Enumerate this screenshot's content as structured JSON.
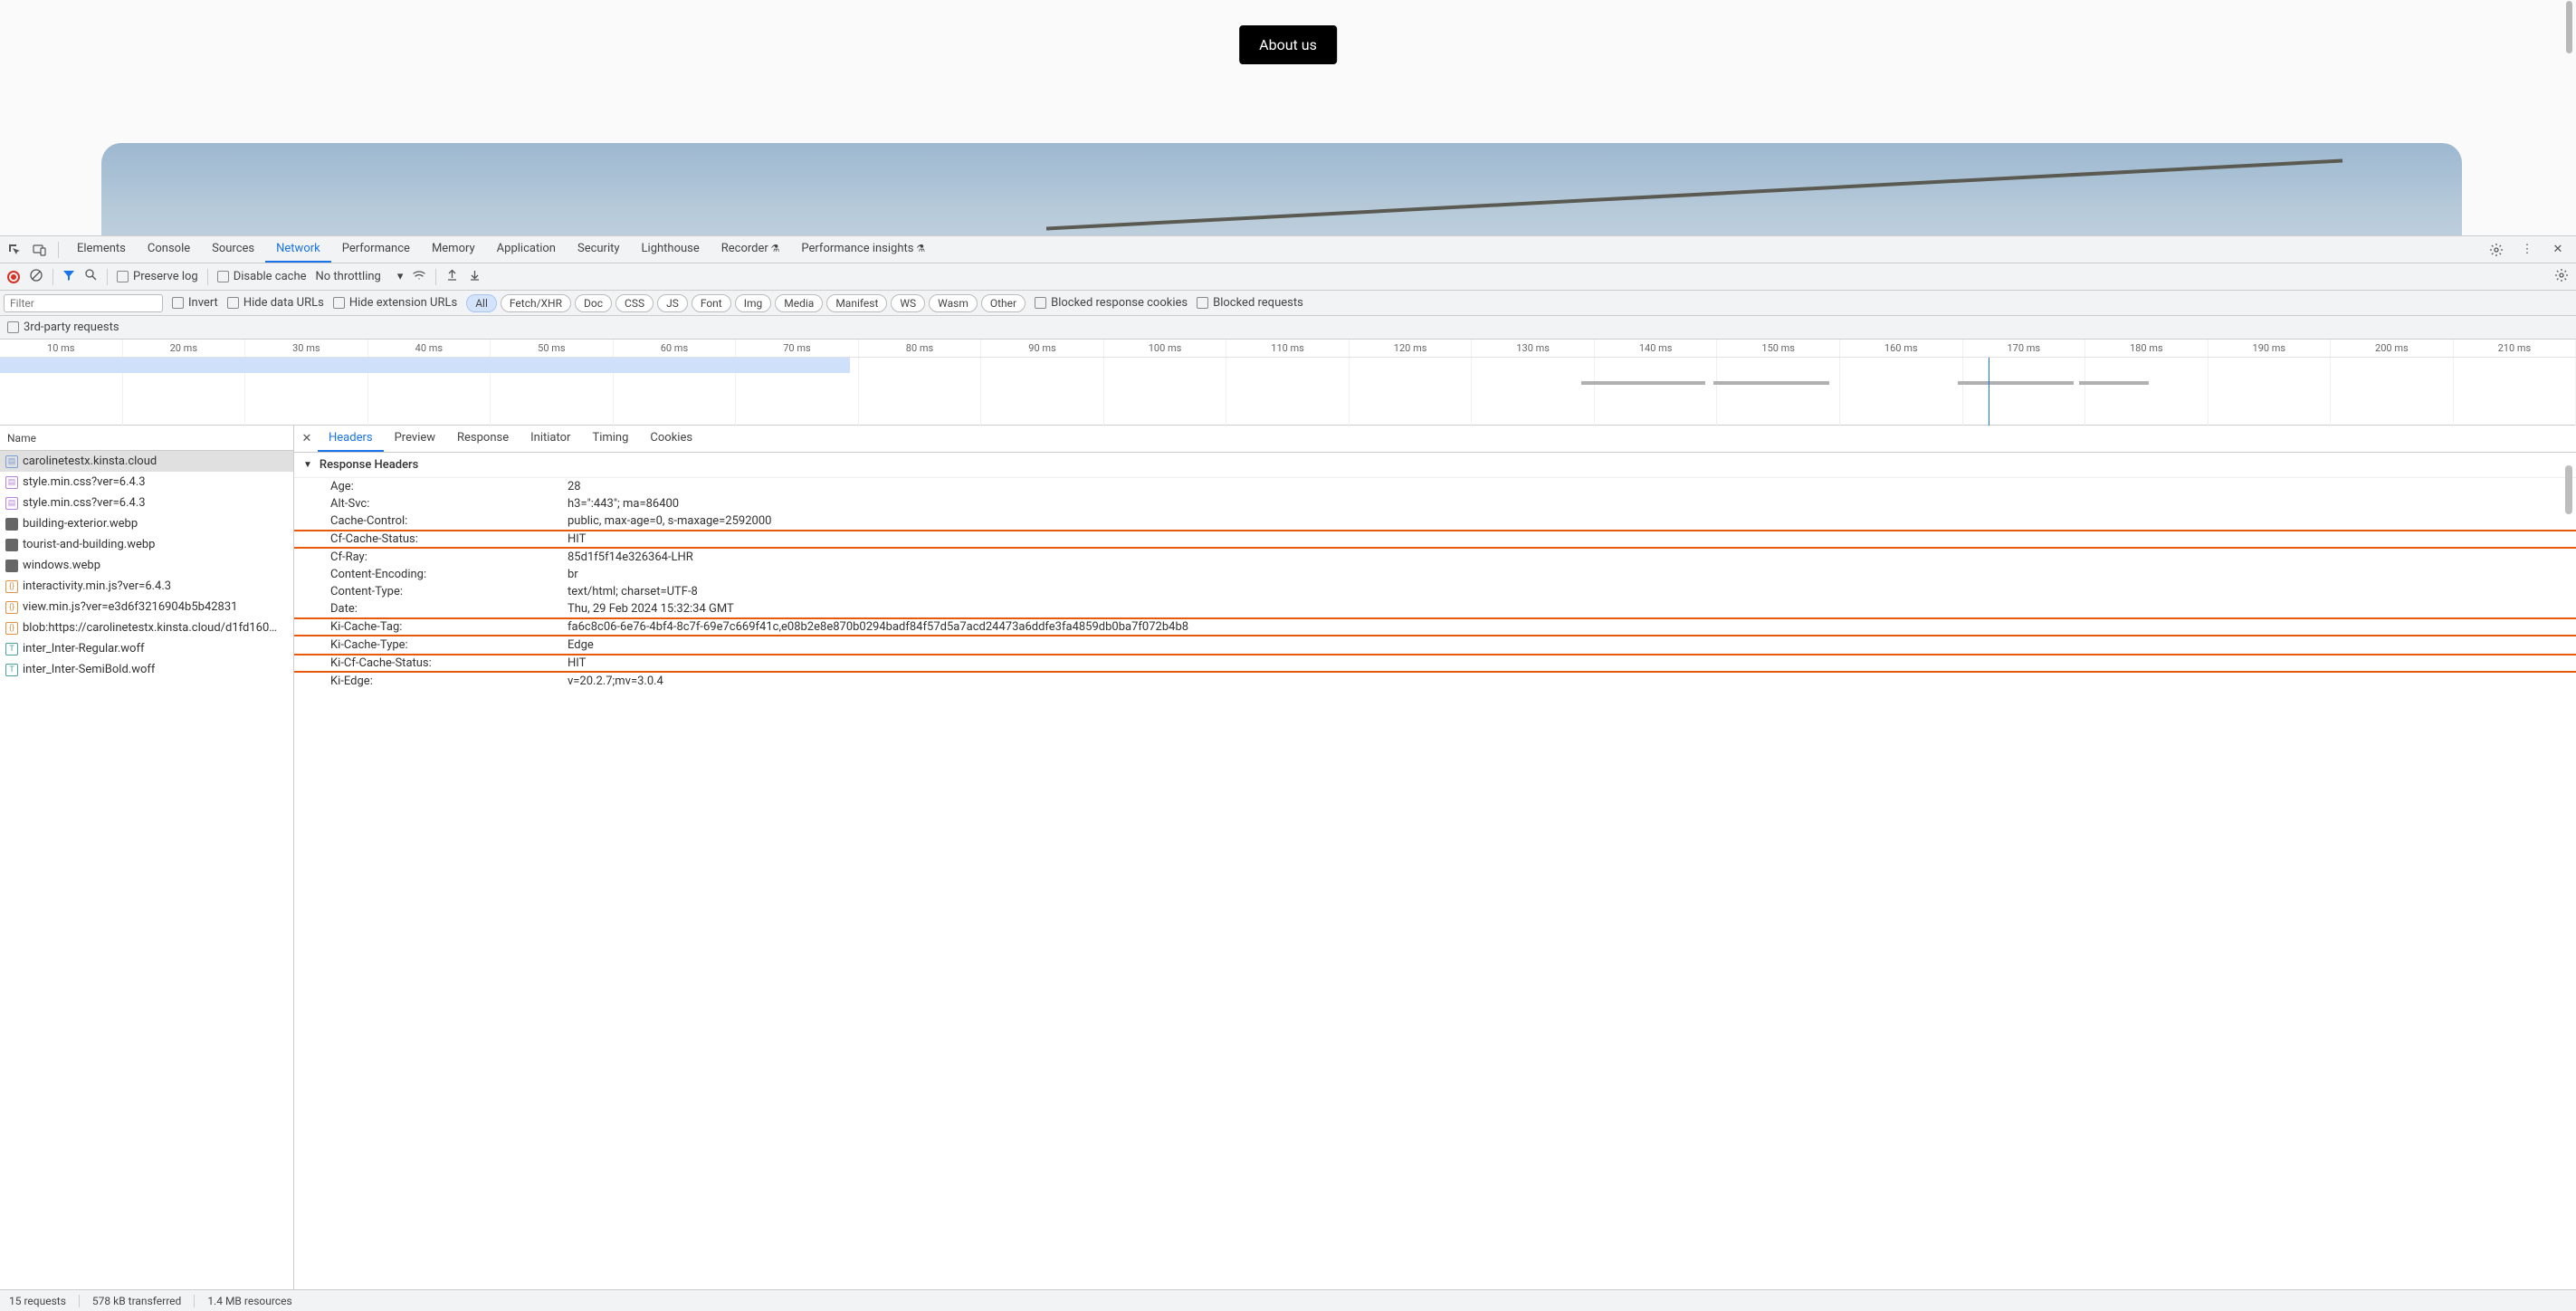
{
  "page": {
    "about_button": "About us"
  },
  "devtools": {
    "tabs": [
      "Elements",
      "Console",
      "Sources",
      "Network",
      "Performance",
      "Memory",
      "Application",
      "Security",
      "Lighthouse",
      "Recorder",
      "Performance insights"
    ],
    "active_tab": 3
  },
  "toolbar": {
    "preserve_log": "Preserve log",
    "disable_cache": "Disable cache",
    "throttling": "No throttling"
  },
  "filterbar": {
    "filter_placeholder": "Filter",
    "invert": "Invert",
    "hide_data": "Hide data URLs",
    "hide_ext": "Hide extension URLs",
    "types": [
      "All",
      "Fetch/XHR",
      "Doc",
      "CSS",
      "JS",
      "Font",
      "Img",
      "Media",
      "Manifest",
      "WS",
      "Wasm",
      "Other"
    ],
    "blocked_cookies": "Blocked response cookies",
    "blocked_requests": "Blocked requests",
    "third_party": "3rd-party requests"
  },
  "timeline": {
    "ticks": [
      "10 ms",
      "20 ms",
      "30 ms",
      "40 ms",
      "50 ms",
      "60 ms",
      "70 ms",
      "80 ms",
      "90 ms",
      "100 ms",
      "110 ms",
      "120 ms",
      "130 ms",
      "140 ms",
      "150 ms",
      "160 ms",
      "170 ms",
      "180 ms",
      "190 ms",
      "200 ms",
      "210 ms"
    ]
  },
  "requests": {
    "name_header": "Name",
    "items": [
      {
        "icon": "doc",
        "name": "carolinetestx.kinsta.cloud",
        "selected": true
      },
      {
        "icon": "css",
        "name": "style.min.css?ver=6.4.3"
      },
      {
        "icon": "css",
        "name": "style.min.css?ver=6.4.3"
      },
      {
        "icon": "img",
        "name": "building-exterior.webp"
      },
      {
        "icon": "img",
        "name": "tourist-and-building.webp"
      },
      {
        "icon": "img",
        "name": "windows.webp"
      },
      {
        "icon": "js",
        "name": "interactivity.min.js?ver=6.4.3"
      },
      {
        "icon": "js",
        "name": "view.min.js?ver=e3d6f3216904b5b42831"
      },
      {
        "icon": "js",
        "name": "blob:https://carolinetestx.kinsta.cloud/d1fd160…"
      },
      {
        "icon": "font",
        "name": "inter_Inter-Regular.woff"
      },
      {
        "icon": "font",
        "name": "inter_Inter-SemiBold.woff"
      }
    ]
  },
  "details": {
    "tabs": [
      "Headers",
      "Preview",
      "Response",
      "Initiator",
      "Timing",
      "Cookies"
    ],
    "active_tab": 0,
    "section": "Response Headers",
    "headers": [
      {
        "key": "Age:",
        "val": "28"
      },
      {
        "key": "Alt-Svc:",
        "val": "h3=\":443\"; ma=86400"
      },
      {
        "key": "Cache-Control:",
        "val": "public, max-age=0, s-maxage=2592000"
      },
      {
        "key": "Cf-Cache-Status:",
        "val": "HIT",
        "hl": true
      },
      {
        "key": "Cf-Ray:",
        "val": "85d1f5f14e326364-LHR"
      },
      {
        "key": "Content-Encoding:",
        "val": "br"
      },
      {
        "key": "Content-Type:",
        "val": "text/html; charset=UTF-8"
      },
      {
        "key": "Date:",
        "val": "Thu, 29 Feb 2024 15:32:34 GMT"
      },
      {
        "key": "Ki-Cache-Tag:",
        "val": "fa6c8c06-6e76-4bf4-8c7f-69e7c669f41c,e08b2e8e870b0294badf84f57d5a7acd24473a6ddfe3fa4859db0ba7f072b4b8",
        "hl": true
      },
      {
        "key": "Ki-Cache-Type:",
        "val": "Edge"
      },
      {
        "key": "Ki-Cf-Cache-Status:",
        "val": "HIT",
        "hl": true
      },
      {
        "key": "Ki-Edge:",
        "val": "v=20.2.7;mv=3.0.4"
      }
    ]
  },
  "status": {
    "requests": "15 requests",
    "transferred": "578 kB transferred",
    "resources": "1.4 MB resources"
  }
}
